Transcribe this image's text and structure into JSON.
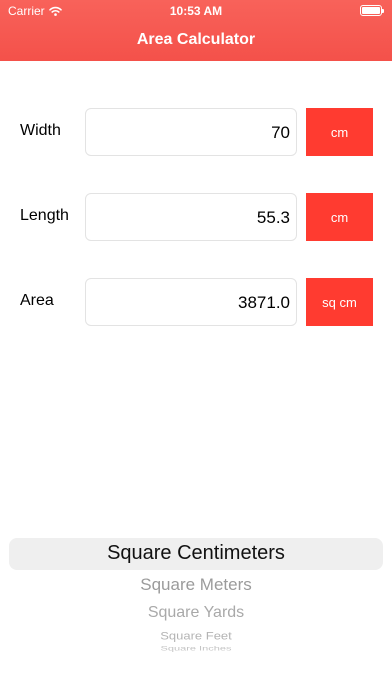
{
  "status_bar": {
    "carrier": "Carrier",
    "time": "10:53 AM"
  },
  "nav": {
    "title": "Area Calculator"
  },
  "fields": [
    {
      "label": "Width",
      "value": "70",
      "unit": "cm"
    },
    {
      "label": "Length",
      "value": "55.3",
      "unit": "cm"
    },
    {
      "label": "Area",
      "value": "3871.0",
      "unit": "sq cm"
    }
  ],
  "picker": {
    "selected": "Square Centimeters",
    "items": [
      "Square Centimeters",
      "Square Meters",
      "Square Yards",
      "Square Feet",
      "Square Inches"
    ]
  },
  "colors": {
    "header": "#f55a52",
    "unit_button": "#ff3b30"
  },
  "icons": [
    "wifi-icon",
    "battery-icon"
  ]
}
